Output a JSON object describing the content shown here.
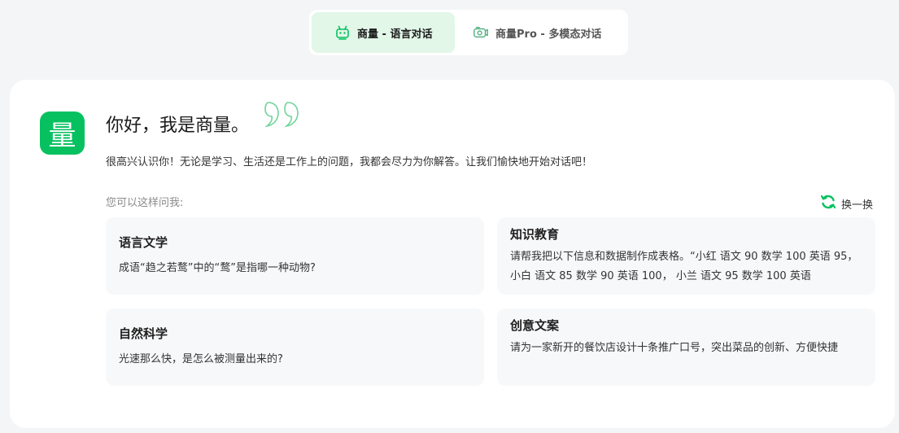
{
  "tabs": [
    {
      "label": "商量 - 语言对话",
      "active": true,
      "icon": "robot-chat-icon"
    },
    {
      "label": "商量Pro - 多模态对话",
      "active": false,
      "icon": "multimodal-chat-icon"
    }
  ],
  "logo": {
    "char": "量",
    "color": "#07c160"
  },
  "greeting": "你好，我是商量。",
  "intro": "很高兴认识你！无论是学习、生活还是工作上的问题，我都会尽力为你解答。让我们愉快地开始对话吧！",
  "suggestions": {
    "label": "您可以这样问我:",
    "refresh_label": "换一换",
    "items": [
      {
        "title": "语言文学",
        "text": "成语“趋之若鹜”中的“鹜”是指哪一种动物?"
      },
      {
        "title": "知识教育",
        "text": "请帮我把以下信息和数据制作成表格。“小红 语文 90 数学 100 英语 95， 小白 语文 85 数学 90 英语 100， 小兰 语文 95 数学 100 英语"
      },
      {
        "title": "自然科学",
        "text": "光速那么快，是怎么被测量出来的?"
      },
      {
        "title": "创意文案",
        "text": "请为一家新开的餐饮店设计十条推广口号，突出菜品的创新、方便快捷"
      }
    ]
  },
  "colors": {
    "accent": "#07c160",
    "active_tab_bg": "#e2f7e8"
  }
}
